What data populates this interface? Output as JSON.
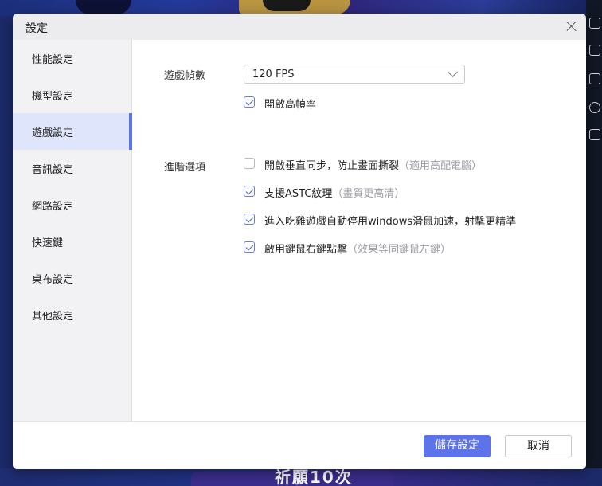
{
  "dialog": {
    "title": "設定"
  },
  "sidebar": {
    "items": [
      {
        "label": "性能設定"
      },
      {
        "label": "機型設定"
      },
      {
        "label": "遊戲設定",
        "active": true
      },
      {
        "label": "音訊設定"
      },
      {
        "label": "網路設定"
      },
      {
        "label": "快速鍵"
      },
      {
        "label": "桌布設定"
      },
      {
        "label": "其他設定"
      }
    ]
  },
  "game": {
    "fps_label": "遊戲幀數",
    "fps_value": "120 FPS",
    "high_fps": {
      "label": "開啟高幀率",
      "checked": true
    },
    "advanced_label": "進階選項",
    "options": [
      {
        "label": "開啟垂直同步，防止畫面撕裂",
        "hint": "（適用高配電腦）",
        "checked": false
      },
      {
        "label": "支援ASTC紋理",
        "hint": "（畫質更高清）",
        "checked": true
      },
      {
        "label": "進入吃雞遊戲自動停用windows滑鼠加速，射擊更精準",
        "hint": "",
        "checked": true
      },
      {
        "label": "啟用鍵鼠右鍵點擊",
        "hint": "（效果等同鍵鼠左鍵）",
        "checked": true
      }
    ]
  },
  "footer": {
    "save_label": "儲存設定",
    "cancel_label": "取消"
  },
  "background": {
    "banner_text": "祈願10次"
  },
  "colors": {
    "accent": "#5d73ea",
    "active_bg": "#dfe5fb"
  }
}
